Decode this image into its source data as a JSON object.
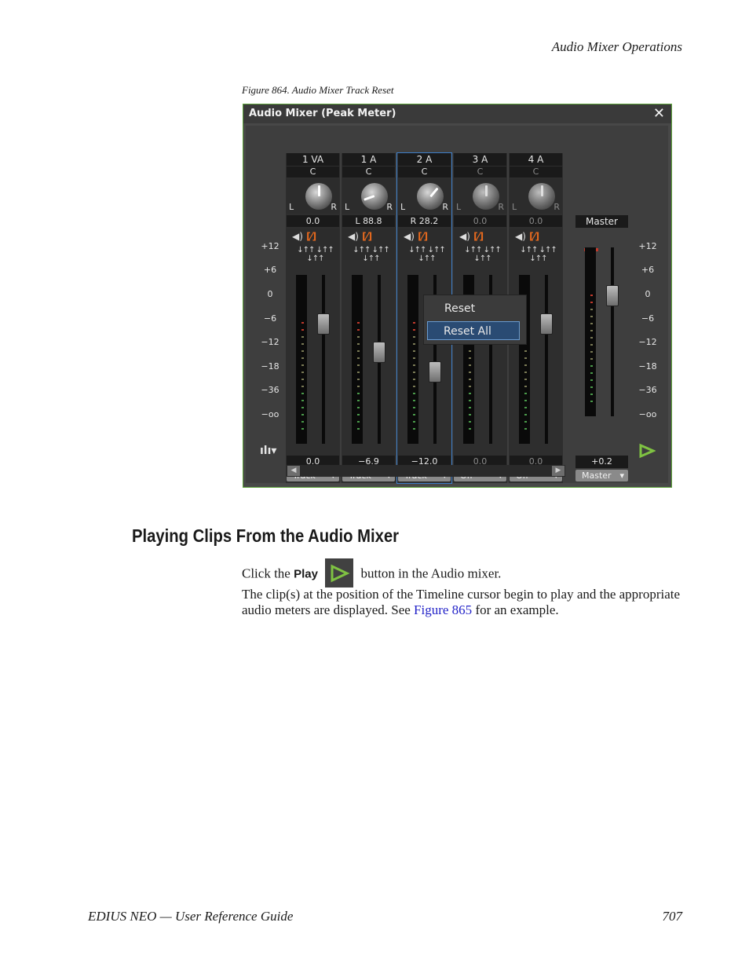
{
  "header": {
    "section": "Audio Mixer Operations"
  },
  "figure": {
    "caption": "Figure 864.  Audio Mixer Track Reset"
  },
  "window": {
    "title": "Audio Mixer (Peak Meter)",
    "close_icon": "close-icon",
    "scale": [
      "+12",
      "+6",
      "0",
      "−6",
      "−12",
      "−18",
      "−36",
      "−oo"
    ],
    "channels": [
      {
        "name": "1 VA",
        "center": "C",
        "left": "L",
        "right": "R",
        "pan": "0.0",
        "gain": "0.0",
        "mode": "Track",
        "fader_level_db": 0,
        "knob_angle_deg": 0
      },
      {
        "name": "1 A",
        "center": "C",
        "left": "L",
        "right": "R",
        "pan": "L 88.8",
        "gain": "−6.9",
        "mode": "Track",
        "fader_level_db": -6.9,
        "knob_angle_deg": -110
      },
      {
        "name": "2 A",
        "center": "C",
        "left": "L",
        "right": "R",
        "pan": "R 28.2",
        "gain": "−12.0",
        "mode": "Track",
        "fader_level_db": -12,
        "knob_angle_deg": 40
      },
      {
        "name": "3 A",
        "center": "C",
        "left": "L",
        "right": "R",
        "pan": "0.0",
        "gain": "0.0",
        "mode": "Off",
        "fader_level_db": 0,
        "knob_angle_deg": 0
      },
      {
        "name": "4 A",
        "center": "C",
        "left": "L",
        "right": "R",
        "pan": "0.0",
        "gain": "0.0",
        "mode": "Off",
        "fader_level_db": 0,
        "knob_angle_deg": 0
      }
    ],
    "master": {
      "name": "Master",
      "gain": "+0.2",
      "mode": "Master"
    },
    "context_menu": {
      "reset": "Reset",
      "reset_all": "Reset All"
    },
    "icon_names": [
      "speaker-icon",
      "mute-icon",
      "fader-settings-icon",
      "meter-menu-icon",
      "play-icon"
    ],
    "colors": {
      "accent": "#5da33a",
      "selected": "#3d7ec9",
      "mute": "#e86a1e"
    }
  },
  "section": {
    "title": "Playing Clips From the Audio Mixer",
    "click_pre": "Click the",
    "play_label": "Play",
    "click_post": "button in the Audio mixer.",
    "para2_pre": "The clip(s) at the position of the Timeline cursor begin to play and the appropriate audio meters are displayed. See",
    "para2_link": "Figure 865",
    "para2_post": "for an example."
  },
  "footer": {
    "left": "EDIUS NEO  —  User Reference Guide",
    "page": "707"
  }
}
